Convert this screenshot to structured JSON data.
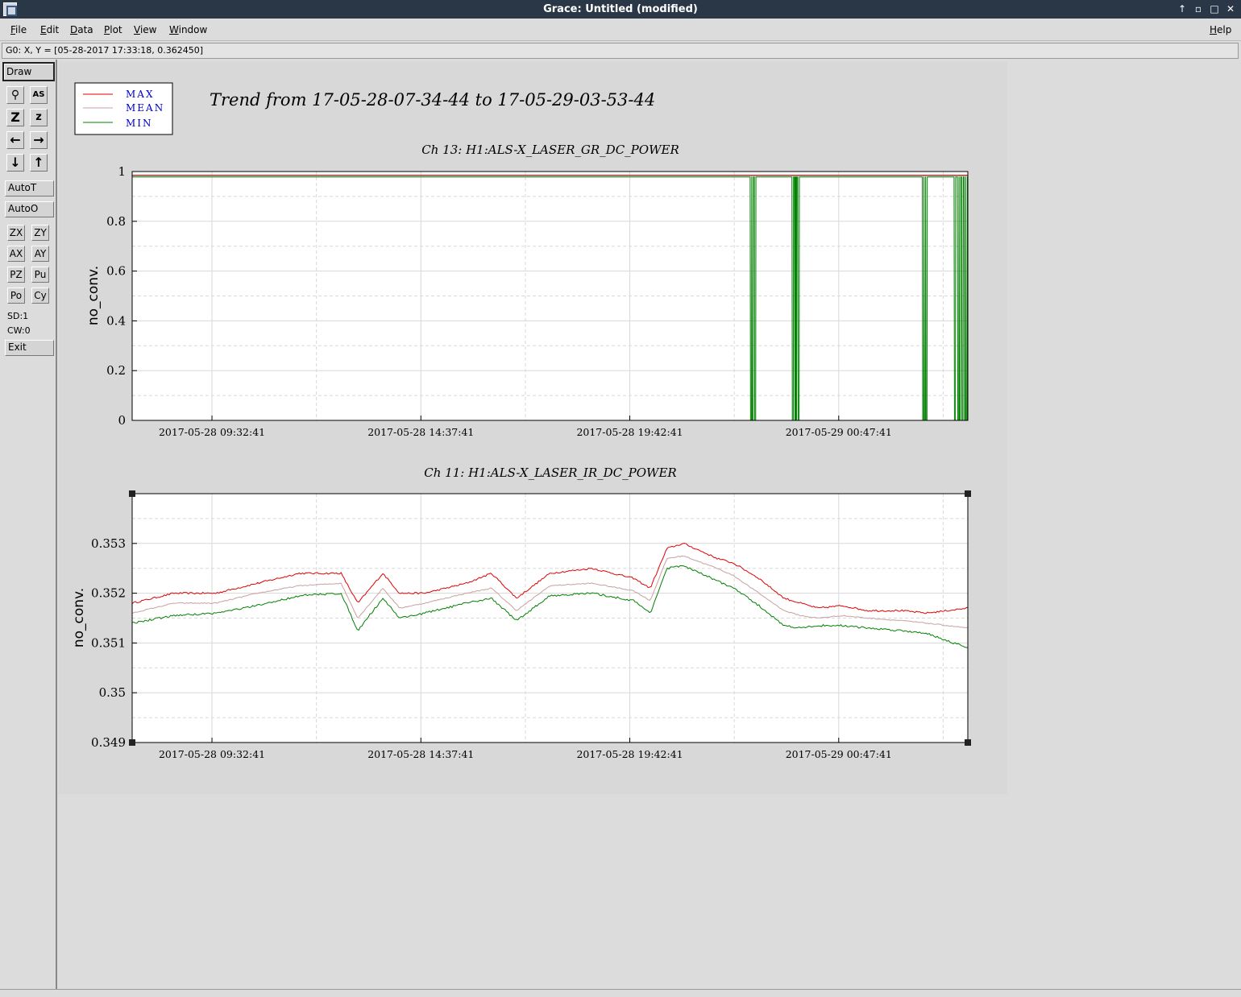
{
  "window": {
    "title": "Grace: Untitled (modified)",
    "ctrl_up": "↑",
    "ctrl_min": "▫",
    "ctrl_max": "□",
    "ctrl_close": "✕"
  },
  "menu": {
    "file": "File",
    "edit": "Edit",
    "data": "Data",
    "plot": "Plot",
    "view": "View",
    "window": "Window",
    "help": "Help"
  },
  "locator": "G0: X, Y = [05-28-2017 17:33:18, 0.362450]",
  "toolbar": {
    "draw": "Draw",
    "autot": "AutoT",
    "autoo": "AutoO",
    "zx": "ZX",
    "zy": "ZY",
    "ax": "AX",
    "ay": "AY",
    "pz": "PZ",
    "pu": "Pu",
    "po": "Po",
    "cy": "Cy",
    "sd": "SD:1",
    "cw": "CW:0",
    "exit": "Exit"
  },
  "statusbar": "",
  "colors": {
    "max": "#e00000",
    "mean": "#c8a0a0",
    "min": "#008000",
    "legend_text": "#0000cc"
  },
  "chart_data": [
    {
      "type": "line",
      "page_title": "Trend from 17-05-28-07-34-44 to 17-05-29-03-53-44",
      "title": "Ch 13: H1:ALS-X_LASER_GR_DC_POWER",
      "ylabel": "no_conv.",
      "xlabel": "",
      "legend": [
        "MAX",
        "MEAN",
        "MIN"
      ],
      "legend_position": "top-left",
      "ylim": [
        0,
        1
      ],
      "yticks": [
        "0",
        "0.2",
        "0.4",
        "0.6",
        "0.8",
        "1"
      ],
      "xticks": [
        "2017-05-28 09:32:41",
        "2017-05-28 14:37:41",
        "2017-05-28 19:42:41",
        "2017-05-29 00:47:41"
      ],
      "xlim": [
        "2017-05-28 07:34:44",
        "2017-05-29 03:53:44"
      ],
      "grid": true,
      "series": [
        {
          "name": "MAX",
          "level": 0.985
        },
        {
          "name": "MEAN",
          "level": 0.982
        },
        {
          "name": "MIN",
          "level": 0.978,
          "dips_fraction_of_span": [
            0.74,
            0.742,
            0.745,
            0.79,
            0.793,
            0.794,
            0.797,
            0.946,
            0.948,
            0.95,
            0.984,
            0.988,
            0.99,
            0.993,
            0.996,
            0.998
          ],
          "dip_value": 0.0
        }
      ]
    },
    {
      "type": "line",
      "title": "Ch 11: H1:ALS-X_LASER_IR_DC_POWER",
      "ylabel": "no_conv.",
      "xlabel": "",
      "ylim": [
        0.349,
        0.354
      ],
      "yticks": [
        "0.349",
        "0.35",
        "0.351",
        "0.352",
        "0.353"
      ],
      "xticks": [
        "2017-05-28 09:32:41",
        "2017-05-28 14:37:41",
        "2017-05-28 19:42:41",
        "2017-05-29 00:47:41"
      ],
      "xlim": [
        "2017-05-28 07:34:44",
        "2017-05-29 03:53:44"
      ],
      "grid": true,
      "series": [
        {
          "name": "MAX",
          "fraction": [
            0.0,
            0.05,
            0.1,
            0.15,
            0.2,
            0.25,
            0.27,
            0.3,
            0.32,
            0.35,
            0.4,
            0.43,
            0.46,
            0.5,
            0.55,
            0.6,
            0.62,
            0.64,
            0.66,
            0.7,
            0.72,
            0.75,
            0.78,
            0.8,
            0.82,
            0.85,
            0.88,
            0.92,
            0.95,
            1.0
          ],
          "values": [
            0.3518,
            0.352,
            0.352,
            0.3522,
            0.3524,
            0.3524,
            0.3518,
            0.3524,
            0.352,
            0.352,
            0.3522,
            0.3524,
            0.3519,
            0.3524,
            0.3525,
            0.3523,
            0.3521,
            0.3529,
            0.353,
            0.3527,
            0.3526,
            0.3523,
            0.3519,
            0.3518,
            0.3517,
            0.35175,
            0.35165,
            0.35165,
            0.3516,
            0.3517
          ]
        },
        {
          "name": "MEAN",
          "fraction": [
            0.0,
            0.05,
            0.1,
            0.15,
            0.2,
            0.25,
            0.27,
            0.3,
            0.32,
            0.35,
            0.4,
            0.43,
            0.46,
            0.5,
            0.55,
            0.6,
            0.62,
            0.64,
            0.66,
            0.7,
            0.72,
            0.75,
            0.78,
            0.8,
            0.82,
            0.85,
            0.88,
            0.92,
            0.95,
            1.0
          ],
          "values": [
            0.3516,
            0.3518,
            0.3518,
            0.352,
            0.35215,
            0.3522,
            0.3515,
            0.3521,
            0.3517,
            0.3518,
            0.352,
            0.3521,
            0.35165,
            0.35215,
            0.3522,
            0.35205,
            0.35185,
            0.3527,
            0.35275,
            0.3525,
            0.35235,
            0.352,
            0.35165,
            0.35155,
            0.3515,
            0.35155,
            0.3515,
            0.35145,
            0.3514,
            0.3513
          ]
        },
        {
          "name": "MIN",
          "fraction": [
            0.0,
            0.05,
            0.1,
            0.15,
            0.2,
            0.25,
            0.27,
            0.3,
            0.32,
            0.35,
            0.4,
            0.43,
            0.46,
            0.5,
            0.55,
            0.6,
            0.62,
            0.64,
            0.66,
            0.7,
            0.72,
            0.75,
            0.78,
            0.8,
            0.82,
            0.85,
            0.88,
            0.92,
            0.95,
            1.0
          ],
          "values": [
            0.3514,
            0.35155,
            0.3516,
            0.35175,
            0.35195,
            0.352,
            0.35125,
            0.3519,
            0.3515,
            0.3516,
            0.3518,
            0.3519,
            0.35145,
            0.35195,
            0.352,
            0.35185,
            0.3516,
            0.3525,
            0.35255,
            0.35225,
            0.3521,
            0.35175,
            0.35135,
            0.3513,
            0.35135,
            0.35135,
            0.3513,
            0.35125,
            0.3512,
            0.3509
          ]
        }
      ]
    }
  ]
}
